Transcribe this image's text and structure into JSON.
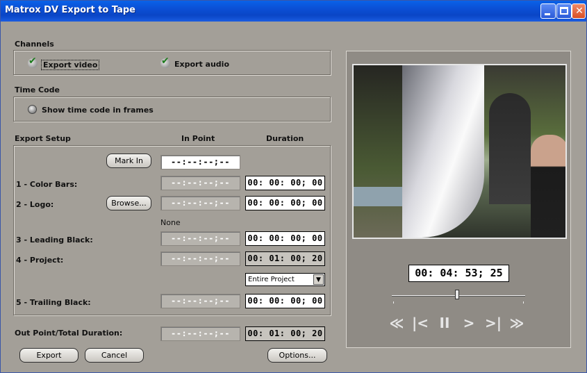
{
  "window": {
    "title": "Matrox DV Export to Tape"
  },
  "channels": {
    "heading": "Channels",
    "export_video": {
      "label": "Export video",
      "checked": true
    },
    "export_audio": {
      "label": "Export audio",
      "checked": true
    }
  },
  "time_code": {
    "heading": "Time Code",
    "show_frames": {
      "label": "Show time code in frames",
      "selected": false
    }
  },
  "export_setup": {
    "heading": "Export Setup",
    "col_in_point": "In Point",
    "col_duration": "Duration",
    "mark_in": {
      "label": "Mark In",
      "value": "--:--:--;--"
    },
    "rows": [
      {
        "label": "1 - Color Bars:",
        "in_point": "--:--:--;--",
        "duration": "00: 00: 00; 00"
      },
      {
        "label": "2 - Logo:",
        "button": "Browse...",
        "in_point": "--:--:--;--",
        "duration": "00: 00: 00; 00",
        "note": "None"
      },
      {
        "label": "3 - Leading Black:",
        "in_point": "--:--:--;--",
        "duration": "00: 00: 00; 00"
      },
      {
        "label": "4 - Project:",
        "in_point": "--:--:--;--",
        "duration": "00: 01: 00; 20",
        "dropdown": "Entire Project"
      },
      {
        "label": "5 - Trailing Black:",
        "in_point": "--:--:--;--",
        "duration": "00: 00: 00; 00"
      }
    ],
    "out_point": {
      "label": "Out Point/Total Duration:",
      "in_point": "--:--:--;--",
      "duration": "00: 01: 00; 20"
    }
  },
  "footer": {
    "export": "Export",
    "cancel": "Cancel",
    "options": "Options..."
  },
  "preview": {
    "timecode": "00: 04: 53; 25",
    "position_fraction": 0.49,
    "transport": [
      "rewind-icon",
      "go-to-start-icon",
      "pause-icon",
      "play-icon",
      "go-to-end-icon",
      "fast-forward-icon"
    ]
  }
}
